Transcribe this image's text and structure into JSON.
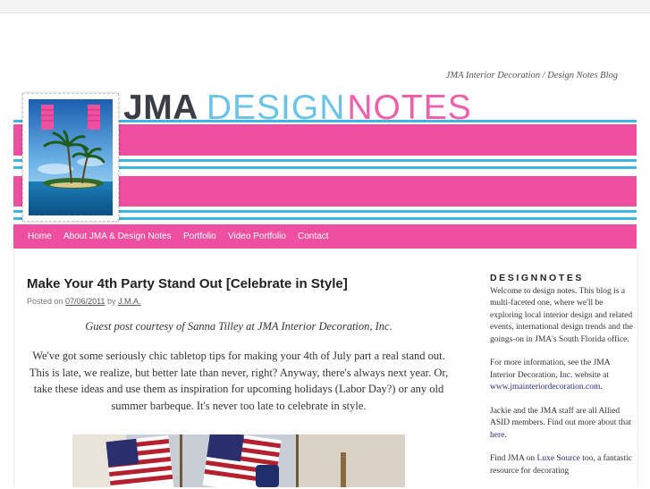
{
  "header": {
    "tagline": "JMA Interior Decoration / Design Notes Blog",
    "logo_jma": "JMA",
    "logo_design": "DESIGN",
    "logo_notes": "NOTES"
  },
  "nav": {
    "items": [
      "Home",
      "About JMA & Design Notes",
      "Portfolio",
      "Video Portfolio",
      "Contact"
    ]
  },
  "post": {
    "title": "Make Your 4th Party Stand Out [Celebrate in Style]",
    "posted_on_label": "Posted on",
    "date": "07/06/2011",
    "by_label": "by",
    "author": "J.M.A.",
    "guest_line": "Guest post courtesy of Sanna Tilley at JMA Interior Decoration, Inc.",
    "paragraph": "We've got some seriously chic tabletop tips for making your 4th of July part a real stand out. This is late, we realize, but better late than never, right? Anyway, there's always next year. Or, take these ideas and use them as inspiration for upcoming holidays (Labor Day?) or any old summer barbeque. It's never too late to celebrate in style."
  },
  "sidebar": {
    "title": "DESIGNNOTES",
    "p1": "Welcome to design notes. This blog is a multi-faceted one, where we'll be exploring local interior design and related events, international design trends and the goings-on in JMA's South Florida office.",
    "p2_text": "For more information, see the JMA Interior Decoration, Inc. website at",
    "p2_link": "www.jmainteriordecoration.com",
    "p2_end": ".",
    "p3_text": "Jackie and the JMA staff are all Allied ASID members. Find out more about that",
    "p3_link": "here",
    "p3_end": ".",
    "p4_text": "Find JMA on",
    "p4_link": "Luxe Source",
    "p4_end": "too, a fantastic resource for decorating"
  },
  "colors": {
    "pink": "#ee4fa0",
    "blue": "#3fb4e6",
    "logo_dark": "#3a3f47",
    "logo_blue": "#6bc3ea",
    "logo_pink": "#ef60ac"
  }
}
